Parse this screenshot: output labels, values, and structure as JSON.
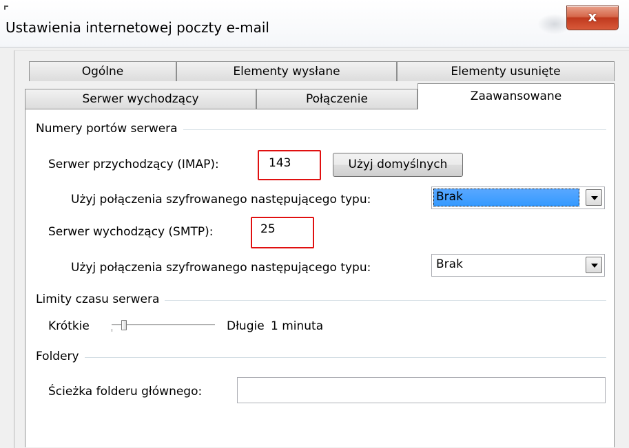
{
  "window": {
    "title": "Ustawienia internetowej poczty e-mail",
    "close_glyph": "x"
  },
  "tabs": {
    "row1": [
      "Ogólne",
      "Elementy wysłane",
      "Elementy usunięte"
    ],
    "row2": [
      "Serwer wychodzący",
      "Połączenie",
      "Zaawansowane"
    ],
    "active": "Zaawansowane"
  },
  "ports": {
    "group_title": "Numery portów serwera",
    "incoming_label": "Serwer przychodzący (IMAP):",
    "incoming_value": "143",
    "default_button": "Użyj domyślnych",
    "encryption_label_1": "Użyj połączenia szyfrowanego następującego typu:",
    "encryption_value_1": "Brak",
    "outgoing_label": "Serwer wychodzący (SMTP):",
    "outgoing_value": "25",
    "encryption_label_2": "Użyj połączenia szyfrowanego następującego typu:",
    "encryption_value_2": "Brak"
  },
  "timeouts": {
    "group_title": "Limity czasu serwera",
    "short_label": "Krótkie",
    "long_label": "Długie",
    "value_label": "1 minuta",
    "slider_level": 0.1
  },
  "folders": {
    "group_title": "Foldery",
    "root_path_label": "Ścieżka folderu głównego:",
    "root_path_value": ""
  },
  "colors": {
    "highlight": "#e01010",
    "selection": "#3399ff",
    "close_button": "#c0391e"
  },
  "icons": {
    "dropdown": "chevron-down-icon",
    "close": "close-icon"
  }
}
